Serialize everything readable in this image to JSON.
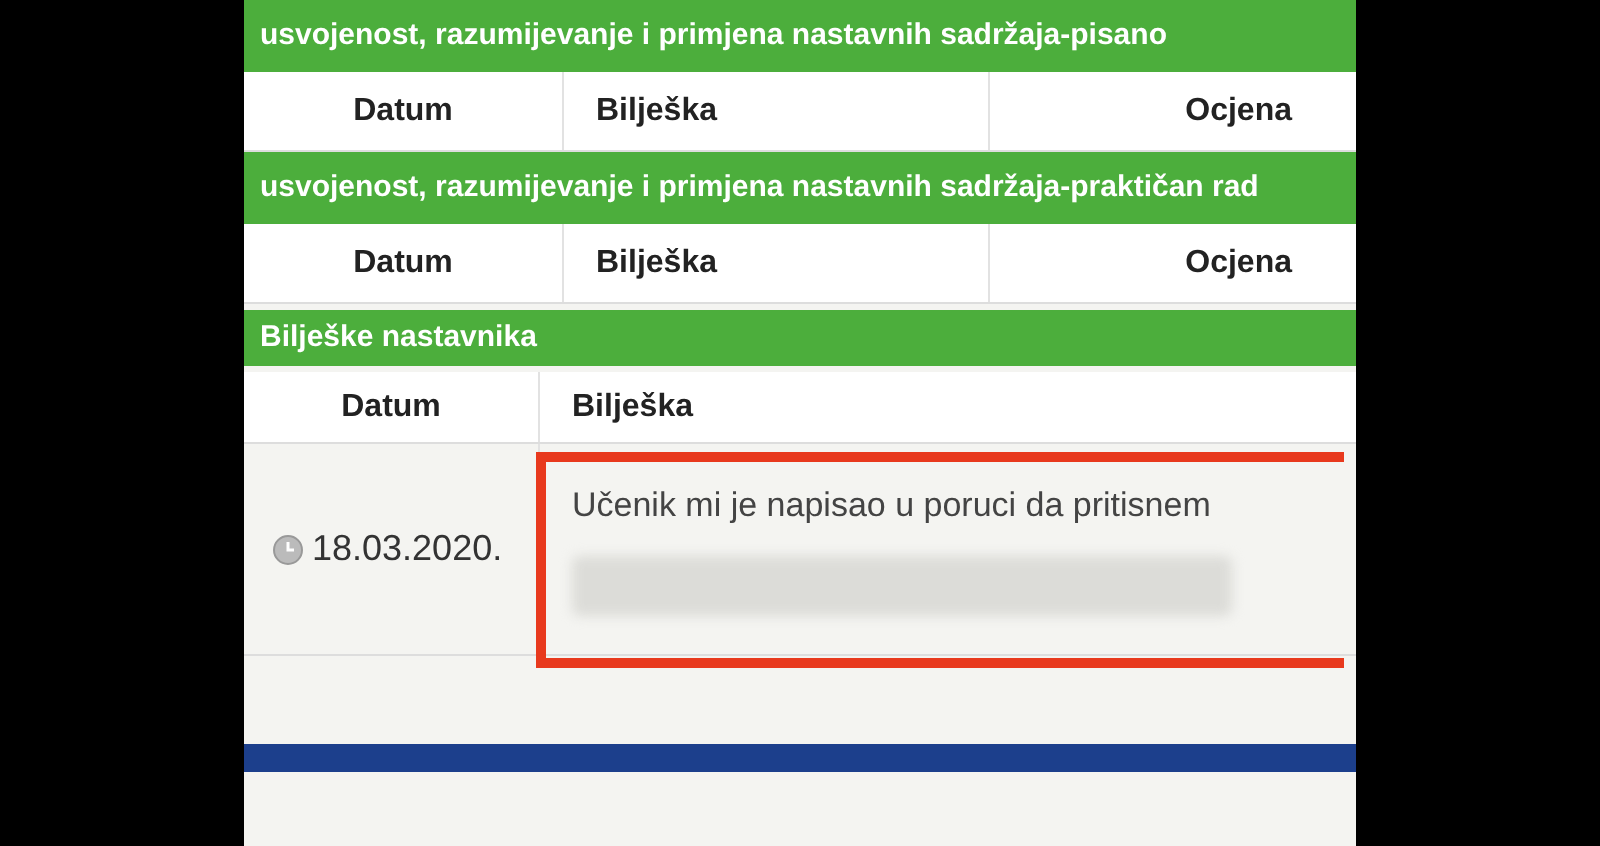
{
  "sections": [
    {
      "title": "usvojenost, razumijevanje i primjena nastavnih sadržaja-pisano",
      "columns": [
        "Datum",
        "Bilješka",
        "Ocjena"
      ]
    },
    {
      "title": "usvojenost, razumijevanje i primjena nastavnih sadržaja-praktičan rad",
      "columns": [
        "Datum",
        "Bilješka",
        "Ocjena"
      ]
    }
  ],
  "notes": {
    "title": "Bilješke nastavnika",
    "columns": [
      "Datum",
      "Bilješka"
    ],
    "rows": [
      {
        "date": "18.03.2020.",
        "note": "Učenik mi je napisao u poruci da pritisnem",
        "highlighted": true
      }
    ]
  }
}
